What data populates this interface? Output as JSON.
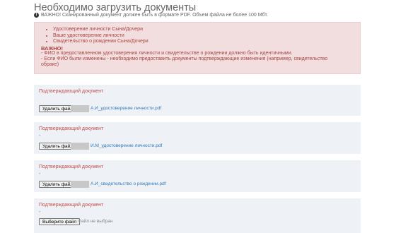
{
  "header": {
    "title": "Необходимо загрузить документы",
    "note": "ВАЖНО! Сканированный документ должен быть в формате PDF. Объем файла не более 100 Мбт."
  },
  "alert": {
    "items": [
      "Удостоверение личности Сына/Дочери",
      "Ваше удостоверение личности",
      "Свидетельство о рождении Сына/Дочери"
    ],
    "important_label": "ВАЖНО!",
    "line1": "- ФИО в предоставленном удостоверения личности и свидетельстве о рождении должно быть идентичными.",
    "line2": "- Если ФИО были изменены - необходимо предоставить документы подтверждающие изменения (например, свидетельство",
    "line3": "обраке)"
  },
  "cards": [
    {
      "label": "Подтверждающий документ",
      "dash": "",
      "button": "Удалить файл",
      "file": "А.И_удостоверение личности.pdf"
    },
    {
      "label": "Подтверждающий документ",
      "dash": "-",
      "button": "Удалить файл",
      "file": "И.М_удостоверение личности.pdf"
    },
    {
      "label": "Подтверждающий документ",
      "dash": "-",
      "button": "Удалить файл",
      "file": "А.И_свидетельство о рождении.pdf"
    },
    {
      "label": "Подтверждающий документ",
      "dash": "-",
      "button": "Выберите файл",
      "file": "Файл не выбран"
    }
  ]
}
